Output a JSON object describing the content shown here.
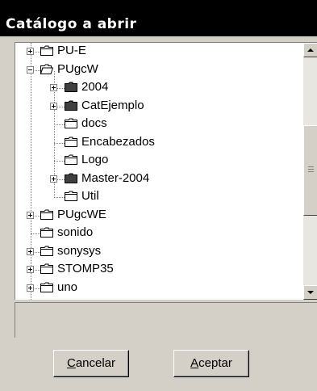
{
  "window": {
    "title": "Catálogo a abrir"
  },
  "tree": {
    "items": [
      {
        "label": "PU-E",
        "level": 1,
        "expander": "plus",
        "icon": "folder-closed"
      },
      {
        "label": "PUgcW",
        "level": 1,
        "expander": "minus",
        "icon": "folder-open"
      },
      {
        "label": "2004",
        "level": 2,
        "expander": "plus",
        "icon": "folder-filled"
      },
      {
        "label": "CatEjemplo",
        "level": 2,
        "expander": "plus",
        "icon": "folder-filled"
      },
      {
        "label": "docs",
        "level": 2,
        "expander": "none",
        "icon": "folder-closed"
      },
      {
        "label": "Encabezados",
        "level": 2,
        "expander": "none",
        "icon": "folder-closed"
      },
      {
        "label": "Logo",
        "level": 2,
        "expander": "none",
        "icon": "folder-closed"
      },
      {
        "label": "Master-2004",
        "level": 2,
        "expander": "plus",
        "icon": "folder-filled"
      },
      {
        "label": "Util",
        "level": 2,
        "expander": "none",
        "icon": "folder-closed"
      },
      {
        "label": "PUgcWE",
        "level": 1,
        "expander": "plus",
        "icon": "folder-closed"
      },
      {
        "label": "sonido",
        "level": 1,
        "expander": "none",
        "icon": "folder-closed"
      },
      {
        "label": "sonysys",
        "level": 1,
        "expander": "plus",
        "icon": "folder-closed"
      },
      {
        "label": "STOMP35",
        "level": 1,
        "expander": "plus",
        "icon": "folder-closed"
      },
      {
        "label": "uno",
        "level": 1,
        "expander": "plus",
        "icon": "folder-closed"
      }
    ]
  },
  "buttons": {
    "cancel": {
      "mnemonic": "C",
      "rest": "ancelar"
    },
    "accept": {
      "mnemonic": "A",
      "rest": "ceptar"
    }
  },
  "status": {
    "text": ""
  }
}
